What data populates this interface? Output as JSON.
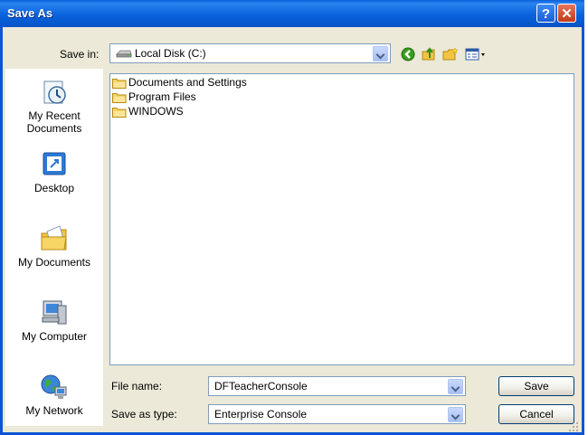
{
  "titlebar": {
    "title": "Save As",
    "help_label": "?",
    "close_label": "✕"
  },
  "save_in": {
    "label": "Save in:",
    "value": "Local Disk (C:)"
  },
  "toolbar": [
    {
      "name": "back-icon"
    },
    {
      "name": "up-folder-icon"
    },
    {
      "name": "new-folder-icon"
    },
    {
      "name": "views-menu-icon"
    }
  ],
  "places": [
    {
      "id": "my-recent-documents",
      "label": "My Recent Documents",
      "icon": "recent-documents-icon"
    },
    {
      "id": "desktop",
      "label": "Desktop",
      "icon": "desktop-icon"
    },
    {
      "id": "my-documents",
      "label": "My Documents",
      "icon": "my-documents-icon"
    },
    {
      "id": "my-computer",
      "label": "My Computer",
      "icon": "my-computer-icon"
    },
    {
      "id": "my-network",
      "label": "My Network",
      "icon": "my-network-icon"
    }
  ],
  "files": [
    {
      "name": "Documents and Settings",
      "icon": "folder-icon"
    },
    {
      "name": "Program Files",
      "icon": "folder-icon"
    },
    {
      "name": "WINDOWS",
      "icon": "folder-icon"
    }
  ],
  "filename": {
    "label": "File name:",
    "value": "DFTeacherConsole"
  },
  "save_type": {
    "label": "Save as type:",
    "value": "Enterprise Console"
  },
  "buttons": {
    "save": "Save",
    "cancel": "Cancel"
  }
}
